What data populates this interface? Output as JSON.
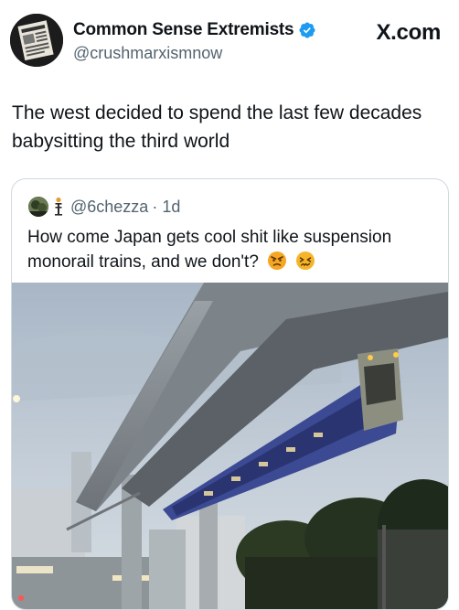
{
  "header": {
    "display_name": "Common Sense Extremists",
    "handle": "@crushmarxismnow",
    "site": "X.com"
  },
  "tweet": {
    "text": "The west decided to spend the last few decades babysitting the third world"
  },
  "quote": {
    "handle": "@6chezza",
    "time": "· 1d",
    "text": "How come Japan gets cool shit like suspension monorail trains, and we don't?"
  },
  "icons": {
    "verified": "verified-badge-icon",
    "x_logo": "x-logo",
    "emoji_1": "angry-face-emoji",
    "emoji_2": "confounded-face-emoji",
    "quote_emoji": "person-emoji"
  },
  "colors": {
    "verified": "#1d9bf0",
    "secondary_text": "#536471",
    "border": "#cfd9de"
  }
}
